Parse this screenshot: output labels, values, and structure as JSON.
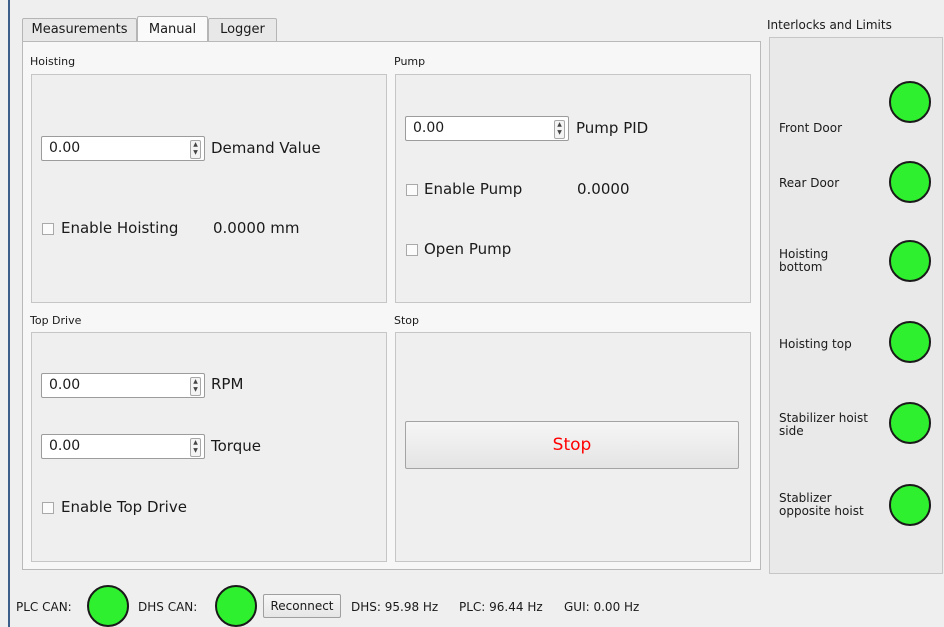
{
  "tabs": [
    "Measurements",
    "Manual",
    "Logger"
  ],
  "active_tab": "Manual",
  "hoisting": {
    "title": "Hoisting",
    "demand_value": "0.00",
    "demand_label": "Demand Value",
    "enable_label": "Enable Hoisting",
    "position": "0.0000 mm"
  },
  "pump": {
    "title": "Pump",
    "pid_value": "0.00",
    "pid_label": "Pump PID",
    "enable_label": "Enable Pump",
    "reading": "0.0000",
    "open_label": "Open Pump"
  },
  "top_drive": {
    "title": "Top Drive",
    "rpm_value": "0.00",
    "rpm_label": "RPM",
    "torque_value": "0.00",
    "torque_label": "Torque",
    "enable_label": "Enable Top Drive"
  },
  "stop": {
    "title": "Stop",
    "button_label": "Stop",
    "button_color": "#ff0000"
  },
  "interlocks": {
    "title": "Interlocks and Limits",
    "items": [
      {
        "label": "Front Door",
        "state_color": "#2ef02e"
      },
      {
        "label": "Rear Door",
        "state_color": "#2ef02e"
      },
      {
        "label": "Hoisting\nbottom",
        "state_color": "#2ef02e"
      },
      {
        "label": "Hoisting top",
        "state_color": "#2ef02e"
      },
      {
        "label": "Stabilizer hoist\nside",
        "state_color": "#2ef02e"
      },
      {
        "label": "Stablizer\nopposite hoist",
        "state_color": "#2ef02e"
      }
    ]
  },
  "status_bar": {
    "plc_can_label": "PLC CAN:",
    "dhs_can_label": "DHS CAN:",
    "reconnect_label": "Reconnect",
    "dhs_rate": "DHS: 95.98 Hz",
    "plc_rate": "PLC: 96.44 Hz",
    "gui_rate": "GUI: 0.00 Hz",
    "led_color": "#2ef02e"
  },
  "icons": {
    "spin_up": "spin-up-icon",
    "spin_down": "spin-down-icon",
    "checkbox": "checkbox-icon",
    "status_led": "status-led-icon"
  }
}
